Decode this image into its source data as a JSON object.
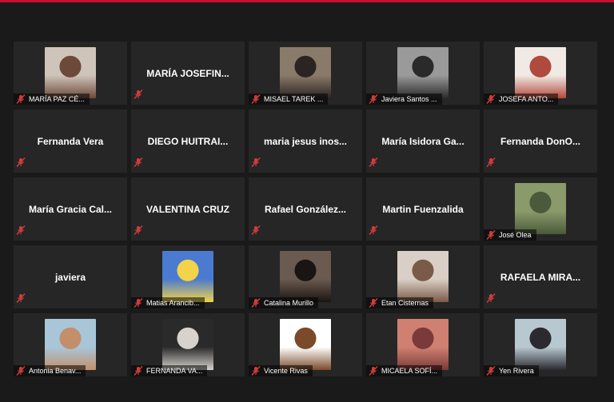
{
  "participants": [
    {
      "name": "MARÍA PAZ CÉ...",
      "has_video": true,
      "video_colors": [
        "#cfc4b9",
        "#6b4a3a"
      ]
    },
    {
      "name": "MARÍA JOSEFIN...",
      "has_video": false
    },
    {
      "name": "MISAEL TAREK ...",
      "has_video": true,
      "video_colors": [
        "#8a7a6a",
        "#2c2420"
      ]
    },
    {
      "name": "Javiera Santos ...",
      "has_video": true,
      "video_colors": [
        "#9a9a9a",
        "#2a2a2a"
      ]
    },
    {
      "name": "JOSEFA ANTO...",
      "has_video": true,
      "video_colors": [
        "#f0e9e4",
        "#b04a3c"
      ]
    },
    {
      "name": "Fernanda Vera",
      "has_video": false
    },
    {
      "name": "DIEGO HUITRAI...",
      "has_video": false
    },
    {
      "name": "maria jesus inos...",
      "has_video": false
    },
    {
      "name": "María Isidora Ga...",
      "has_video": false
    },
    {
      "name": "Fernanda DonO...",
      "has_video": false
    },
    {
      "name": "María Gracia Cal...",
      "has_video": false
    },
    {
      "name": "VALENTINA CRUZ",
      "has_video": false
    },
    {
      "name": "Rafael González...",
      "has_video": false
    },
    {
      "name": "Martin Fuenzalida",
      "has_video": false
    },
    {
      "name": "José Olea",
      "has_video": true,
      "video_colors": [
        "#8a9a6a",
        "#4a5a3a"
      ]
    },
    {
      "name": "javiera",
      "has_video": false
    },
    {
      "name": "Matias Arancib...",
      "has_video": true,
      "video_colors": [
        "#4a7bd0",
        "#f2d34a"
      ]
    },
    {
      "name": "Catalina Murillo",
      "has_video": true,
      "video_colors": [
        "#6a5a50",
        "#1a1412"
      ]
    },
    {
      "name": "Etan Cisternas",
      "has_video": true,
      "video_colors": [
        "#d9cfc6",
        "#7a5a48"
      ]
    },
    {
      "name": "RAFAELA MIRA...",
      "has_video": false
    },
    {
      "name": "Antonia Benav...",
      "has_video": true,
      "video_colors": [
        "#a8c6d8",
        "#c28f6a"
      ]
    },
    {
      "name": "FERNANDA VA...",
      "has_video": true,
      "video_colors": [
        "#2a2a2a",
        "#d8d2cc"
      ]
    },
    {
      "name": "Vicente Rivas",
      "has_video": true,
      "video_colors": [
        "#ffffff",
        "#7a4a2a"
      ]
    },
    {
      "name": "MICAELA SOFÍ...",
      "has_video": true,
      "video_colors": [
        "#d08070",
        "#7a3a3a"
      ]
    },
    {
      "name": "Yen Rivera",
      "has_video": true,
      "video_colors": [
        "#b8c8d0",
        "#2a2a30"
      ]
    }
  ],
  "colors": {
    "background": "#1a1a1a",
    "tile": "#262626",
    "accent_bar": "#c8102e",
    "muted_icon": "#d23b3b"
  },
  "icons": {
    "muted": "mic-muted-icon"
  }
}
